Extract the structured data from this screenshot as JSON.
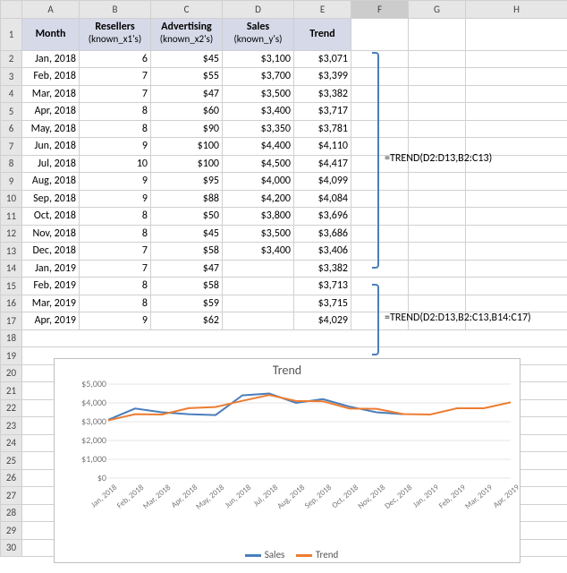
{
  "columns": [
    "",
    "A",
    "B",
    "C",
    "D",
    "E",
    "F",
    "G",
    "H"
  ],
  "headers": {
    "A": "Month",
    "B": "Resellers",
    "B2": "(known_x1's)",
    "C": "Advertising",
    "C2": "(known_x2's)",
    "D": "Sales",
    "D2": "(known_y's)",
    "E": "Trend"
  },
  "rows": [
    {
      "n": 2,
      "A": "Jan, 2018",
      "B": "6",
      "C": "$45",
      "D": "$3,100",
      "E": "$3,071"
    },
    {
      "n": 3,
      "A": "Feb, 2018",
      "B": "7",
      "C": "$55",
      "D": "$3,700",
      "E": "$3,399"
    },
    {
      "n": 4,
      "A": "Mar, 2018",
      "B": "7",
      "C": "$47",
      "D": "$3,500",
      "E": "$3,382"
    },
    {
      "n": 5,
      "A": "Apr, 2018",
      "B": "8",
      "C": "$60",
      "D": "$3,400",
      "E": "$3,717"
    },
    {
      "n": 6,
      "A": "May, 2018",
      "B": "8",
      "C": "$90",
      "D": "$3,350",
      "E": "$3,781"
    },
    {
      "n": 7,
      "A": "Jun, 2018",
      "B": "9",
      "C": "$100",
      "D": "$4,400",
      "E": "$4,110"
    },
    {
      "n": 8,
      "A": "Jul, 2018",
      "B": "10",
      "C": "$100",
      "D": "$4,500",
      "E": "$4,417"
    },
    {
      "n": 9,
      "A": "Aug, 2018",
      "B": "9",
      "C": "$95",
      "D": "$4,000",
      "E": "$4,099"
    },
    {
      "n": 10,
      "A": "Sep, 2018",
      "B": "9",
      "C": "$88",
      "D": "$4,200",
      "E": "$4,084"
    },
    {
      "n": 11,
      "A": "Oct, 2018",
      "B": "8",
      "C": "$50",
      "D": "$3,800",
      "E": "$3,696"
    },
    {
      "n": 12,
      "A": "Nov, 2018",
      "B": "8",
      "C": "$45",
      "D": "$3,500",
      "E": "$3,686"
    },
    {
      "n": 13,
      "A": "Dec, 2018",
      "B": "7",
      "C": "$58",
      "D": "$3,400",
      "E": "$3,406"
    },
    {
      "n": 14,
      "A": "Jan, 2019",
      "B": "7",
      "C": "$47",
      "D": "",
      "E": "$3,382"
    },
    {
      "n": 15,
      "A": "Feb, 2019",
      "B": "8",
      "C": "$58",
      "D": "",
      "E": "$3,713"
    },
    {
      "n": 16,
      "A": "Mar, 2019",
      "B": "8",
      "C": "$59",
      "D": "",
      "E": "$3,715"
    },
    {
      "n": 17,
      "A": "Apr, 2019",
      "B": "9",
      "C": "$62",
      "D": "",
      "E": "$4,029"
    }
  ],
  "blank_rows": [
    18,
    19,
    20,
    21,
    22,
    23,
    24,
    25,
    26,
    27,
    28,
    29,
    30
  ],
  "annotations": {
    "f1": "=TREND(D2:D13,B2:C13)",
    "f2": "=TREND(D2:D13,B2:C13,B14:C17)"
  },
  "chart_data": {
    "type": "line",
    "title": "Trend",
    "categories": [
      "Jan, 2018",
      "Feb, 2018",
      "Mar, 2018",
      "Apr, 2018",
      "May, 2018",
      "Jun, 2018",
      "Jul, 2018",
      "Aug, 2018",
      "Sep, 2018",
      "Oct, 2018",
      "Nov, 2018",
      "Dec, 2018",
      "Jan, 2019",
      "Feb, 2019",
      "Mar, 2019",
      "Apr, 2019"
    ],
    "series": [
      {
        "name": "Sales",
        "color": "#4a7ebb",
        "values": [
          3100,
          3700,
          3500,
          3400,
          3350,
          4400,
          4500,
          4000,
          4200,
          3800,
          3500,
          3400,
          null,
          null,
          null,
          null
        ]
      },
      {
        "name": "Trend",
        "color": "#ed7d31",
        "values": [
          3071,
          3399,
          3382,
          3717,
          3781,
          4110,
          4417,
          4099,
          4084,
          3696,
          3686,
          3406,
          3382,
          3713,
          3715,
          4029
        ]
      }
    ],
    "ylim": [
      0,
      5000
    ],
    "yticks": [
      "$0",
      "$1,000",
      "$2,000",
      "$3,000",
      "$4,000",
      "$5,000"
    ],
    "legend_position": "bottom"
  }
}
